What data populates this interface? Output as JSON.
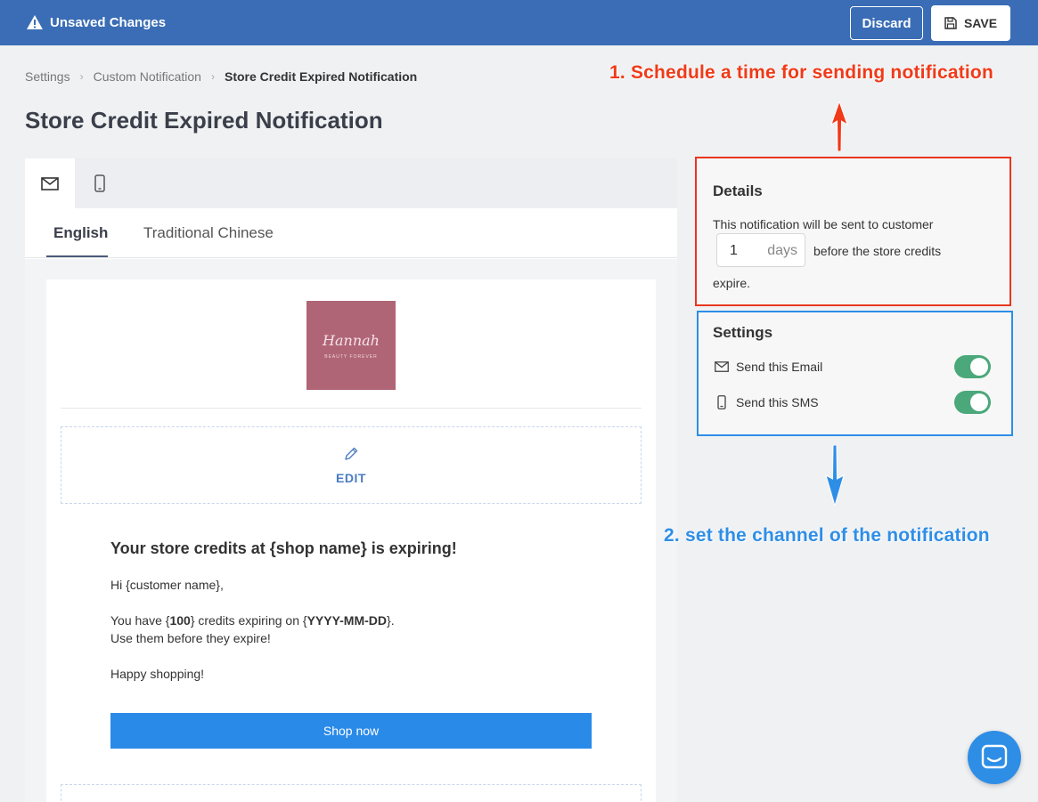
{
  "topbar": {
    "title": "Unsaved Changes",
    "discard_label": "Discard",
    "save_label": "SAVE",
    "color": "#3a6db5"
  },
  "breadcrumb": [
    "Settings",
    "Custom Notification",
    "Store Credit Expired Notification"
  ],
  "page_title": "Store Credit Expired Notification",
  "editor": {
    "channel_tabs": [
      {
        "icon": "mail-icon",
        "active": true
      },
      {
        "icon": "mobile-icon",
        "active": false
      }
    ],
    "language_tabs": [
      {
        "label": "English",
        "active": true
      },
      {
        "label": "Traditional Chinese",
        "active": false
      }
    ],
    "logo": {
      "name": "Hannah",
      "tagline": "BEAUTY FOREVER"
    },
    "edit_label": "EDIT",
    "email": {
      "heading": "Your store credits at {shop name} is expiring!",
      "greeting": "Hi {customer name},",
      "line1_prefix": "You have {",
      "credits": "100",
      "line1_mid": "} credits expiring on {",
      "date": "YYYY-MM-DD",
      "line1_suffix": "}.",
      "line2": "Use them before they expire!",
      "signoff": "Happy shopping!",
      "button": "Shop now"
    }
  },
  "details": {
    "title": "Details",
    "text_before": "This notification will be sent to customer",
    "days_value": "1",
    "days_unit": "days",
    "text_after": "before the store credits",
    "text_end": "expire."
  },
  "settings": {
    "title": "Settings",
    "items": [
      {
        "label": "Send this Email",
        "icon": "mail-icon",
        "enabled": true
      },
      {
        "label": "Send this SMS",
        "icon": "mobile-icon",
        "enabled": true
      }
    ]
  },
  "annotations": {
    "step1": "1. Schedule a time for sending notification",
    "step2": "2. set the channel of the notification",
    "step1_color": "#f03a18",
    "step2_color": "#2e8ee6"
  }
}
